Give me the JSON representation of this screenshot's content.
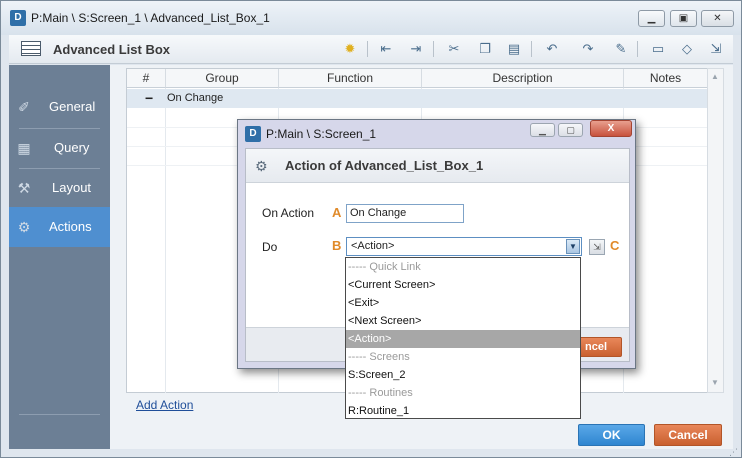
{
  "window": {
    "title": "P:Main \\ S:Screen_1 \\ Advanced_List_Box_1",
    "logo_text": "D",
    "controls": [
      "minimize-icon",
      "maximize-icon",
      "close-icon"
    ]
  },
  "toolbar": {
    "title": "Advanced List Box",
    "icons": [
      "lightbulb-icon",
      "outdent-icon",
      "indent-icon",
      "cut-icon",
      "copy-icon",
      "paste-icon",
      "undo-icon",
      "redo-icon",
      "comment-icon",
      "speech-bubble-icon",
      "tag-icon",
      "export-icon"
    ]
  },
  "sidebar": {
    "items": [
      {
        "label": "General",
        "icon": "general-icon"
      },
      {
        "label": "Query",
        "icon": "query-icon"
      },
      {
        "label": "Layout",
        "icon": "layout-icon"
      },
      {
        "label": "Actions",
        "icon": "actions-icon",
        "active": true
      }
    ]
  },
  "grid": {
    "columns": [
      "#",
      "Group",
      "Function",
      "Description",
      "Notes"
    ],
    "group_row": {
      "toggle": "−",
      "label": "On Change"
    }
  },
  "add_action_label": "Add Action",
  "ok_label": "OK",
  "cancel_label": "Cancel",
  "dialog": {
    "window_title": "P:Main \\ S:Screen_1",
    "logo_text": "D",
    "close_label": "X",
    "header": "Action of Advanced_List_Box_1",
    "on_action_label": "On Action",
    "on_action_marker": "A",
    "on_action_value": "On Change",
    "do_label": "Do",
    "do_marker": "B",
    "do_value": "<Action>",
    "edit_marker": "C",
    "cancel_partial": "ncel"
  },
  "dropdown": {
    "options": [
      {
        "text": "----- Quick Link",
        "type": "header"
      },
      {
        "text": "<Current Screen>",
        "type": "item"
      },
      {
        "text": "<Exit>",
        "type": "item"
      },
      {
        "text": "<Next Screen>",
        "type": "item"
      },
      {
        "text": "<Action>",
        "type": "selected"
      },
      {
        "text": "----- Screens",
        "type": "header"
      },
      {
        "text": "S:Screen_2",
        "type": "item"
      },
      {
        "text": "----- Routines",
        "type": "header"
      },
      {
        "text": "R:Routine_1",
        "type": "item"
      }
    ]
  },
  "colors": {
    "sidebar_bg": "#6c7f95",
    "sidebar_active": "#4f8fd0",
    "ok_bg": "#2f86d0",
    "cancel_bg": "#c9602f",
    "marker": "#e08a2a",
    "dropdown_selected": "#a7a7a7"
  }
}
